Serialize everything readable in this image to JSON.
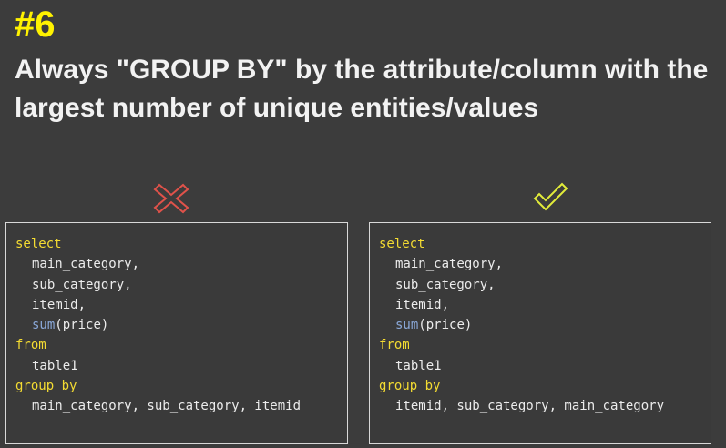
{
  "tip": {
    "number": "#6",
    "headline": "Always \"GROUP BY\" by the attribute/column with the largest number of unique entities/values"
  },
  "colors": {
    "background": "#3c3c3c",
    "accent_yellow": "#fff200",
    "keyword": "#f4dc32",
    "function": "#8aa8d8",
    "wrong_mark": "#e0524a",
    "right_mark": "#e2ec3a"
  },
  "wrong_example": {
    "icon": "cross-icon",
    "lines": [
      {
        "text": "select",
        "kind": "kw",
        "indent": false
      },
      {
        "text": "main_category,",
        "kind": "plain",
        "indent": true
      },
      {
        "text": "sub_category,",
        "kind": "plain",
        "indent": true
      },
      {
        "text": "itemid,",
        "kind": "plain",
        "indent": true
      },
      {
        "fn": "sum",
        "text": "(price)",
        "kind": "fncall",
        "indent": true
      },
      {
        "text": "from",
        "kind": "kw",
        "indent": false
      },
      {
        "text": "table1",
        "kind": "plain",
        "indent": true
      },
      {
        "text": "group by",
        "kind": "kw",
        "indent": false
      },
      {
        "text": "main_category, sub_category, itemid",
        "kind": "plain",
        "indent": true
      }
    ]
  },
  "right_example": {
    "icon": "checkmark-icon",
    "lines": [
      {
        "text": "select",
        "kind": "kw",
        "indent": false
      },
      {
        "text": "main_category,",
        "kind": "plain",
        "indent": true
      },
      {
        "text": "sub_category,",
        "kind": "plain",
        "indent": true
      },
      {
        "text": "itemid,",
        "kind": "plain",
        "indent": true
      },
      {
        "fn": "sum",
        "text": "(price)",
        "kind": "fncall",
        "indent": true
      },
      {
        "text": "from",
        "kind": "kw",
        "indent": false
      },
      {
        "text": "table1",
        "kind": "plain",
        "indent": true
      },
      {
        "text": "group by",
        "kind": "kw",
        "indent": false
      },
      {
        "text": "itemid, sub_category, main_category",
        "kind": "plain",
        "indent": true
      }
    ]
  }
}
